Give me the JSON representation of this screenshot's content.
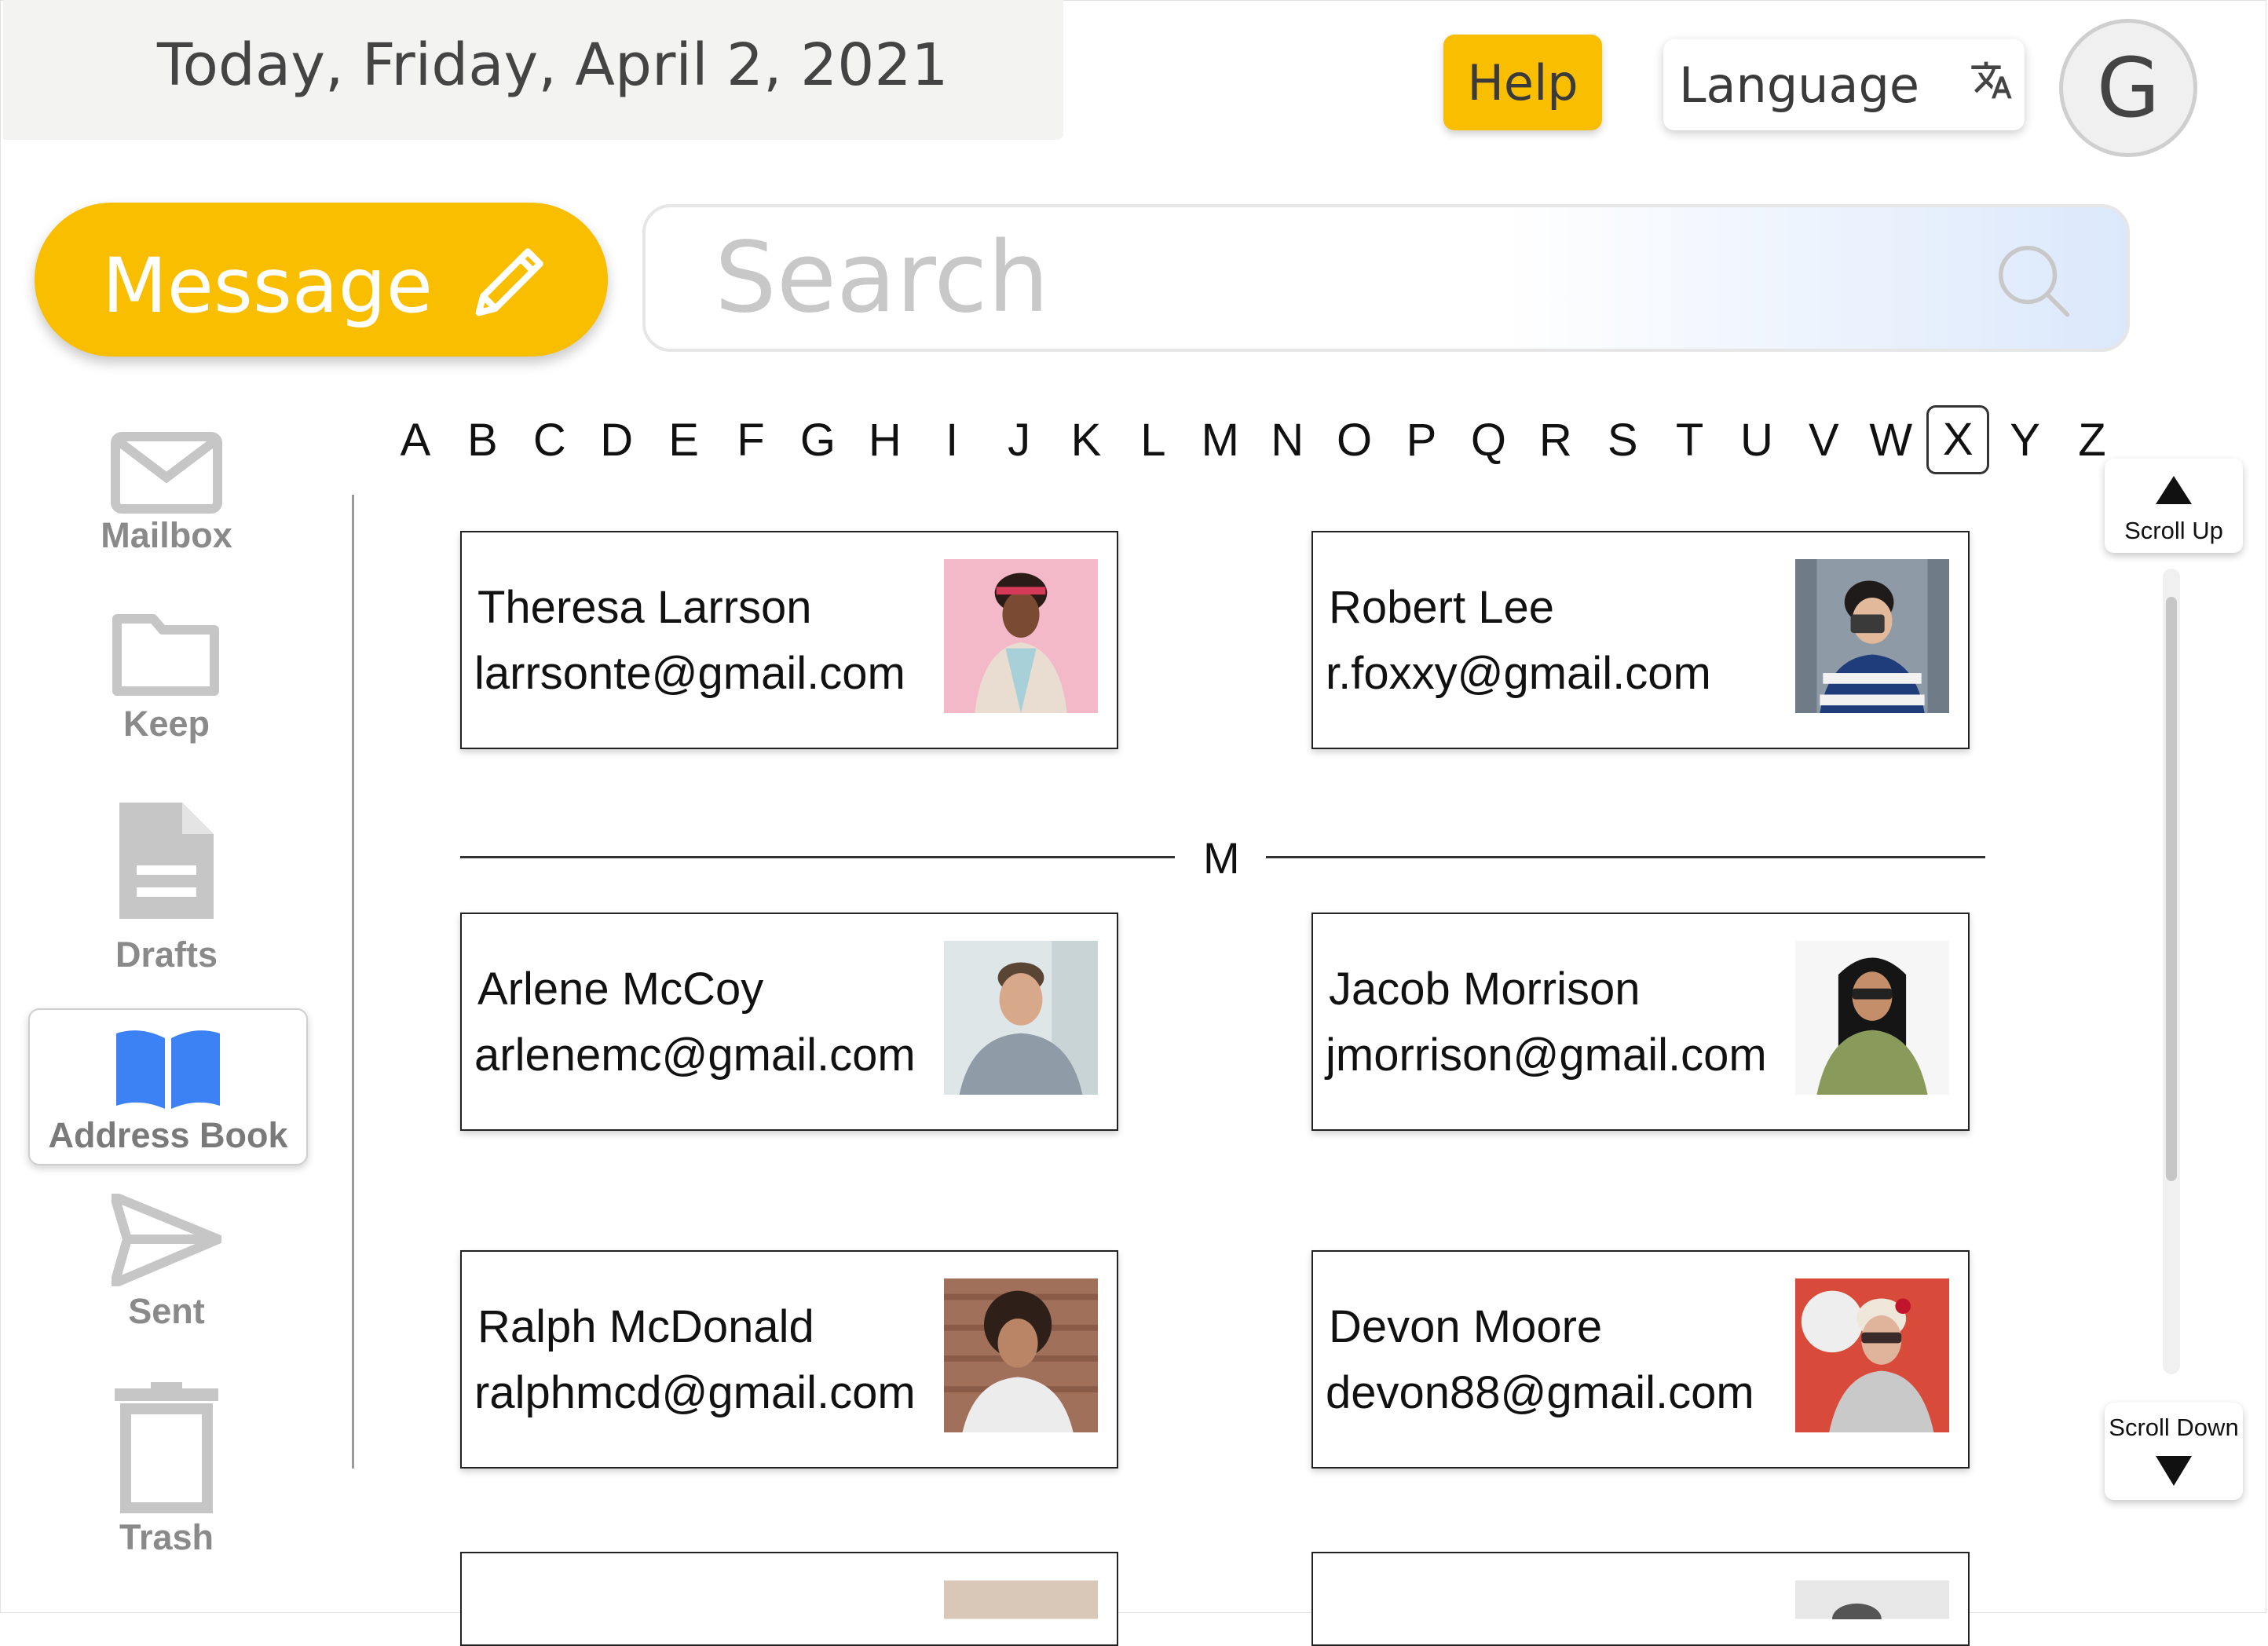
{
  "header": {
    "date_text": "Today, Friday, April 2, 2021",
    "help_label": "Help",
    "language_label": "Language",
    "language_icon": "translate-icon",
    "avatar_initial": "G"
  },
  "compose": {
    "message_label": "Message",
    "icon": "pencil-icon"
  },
  "search": {
    "placeholder": "Search",
    "value": "",
    "icon": "search-icon"
  },
  "sidebar": {
    "items": [
      {
        "label": "Mailbox",
        "icon": "envelope-icon",
        "active": false
      },
      {
        "label": "Keep",
        "icon": "folder-icon",
        "active": false
      },
      {
        "label": "Drafts",
        "icon": "document-icon",
        "active": false
      },
      {
        "label": "Address Book",
        "icon": "book-icon",
        "active": true
      },
      {
        "label": "Sent",
        "icon": "paper-plane-icon",
        "active": false
      },
      {
        "label": "Trash",
        "icon": "trash-icon",
        "active": false
      }
    ]
  },
  "alphabet": {
    "letters": [
      "A",
      "B",
      "C",
      "D",
      "E",
      "F",
      "G",
      "H",
      "I",
      "J",
      "K",
      "L",
      "M",
      "N",
      "O",
      "P",
      "Q",
      "R",
      "S",
      "T",
      "U",
      "V",
      "W",
      "X",
      "Y",
      "Z"
    ],
    "selected": "X"
  },
  "contacts": {
    "section_letter": "M",
    "cards": [
      {
        "name": "Theresa Larrson",
        "email": "larrsonte@gmail.com",
        "photo": "woman-pink-background-photo"
      },
      {
        "name": "Robert Lee",
        "email": "r.foxxy@gmail.com",
        "photo": "man-with-camera-photo"
      },
      {
        "name": "Arlene McCoy",
        "email": "arlenemc@gmail.com",
        "photo": "man-grey-shirt-photo"
      },
      {
        "name": "Jacob Morrison",
        "email": "jmorrison@gmail.com",
        "photo": "man-long-hair-glasses-photo"
      },
      {
        "name": "Ralph McDonald",
        "email": "ralphmcd@gmail.com",
        "photo": "man-curly-hair-brick-wall-photo"
      },
      {
        "name": "Devon Moore",
        "email": "devon88@gmail.com",
        "photo": "woman-retro-glasses-photo"
      }
    ]
  },
  "scroll": {
    "up_label": "Scroll Up",
    "down_label": "Scroll Down"
  },
  "colors": {
    "accent": "#f9be00",
    "active_icon": "#3d82f4",
    "inactive_icon": "#c6c6c6"
  }
}
